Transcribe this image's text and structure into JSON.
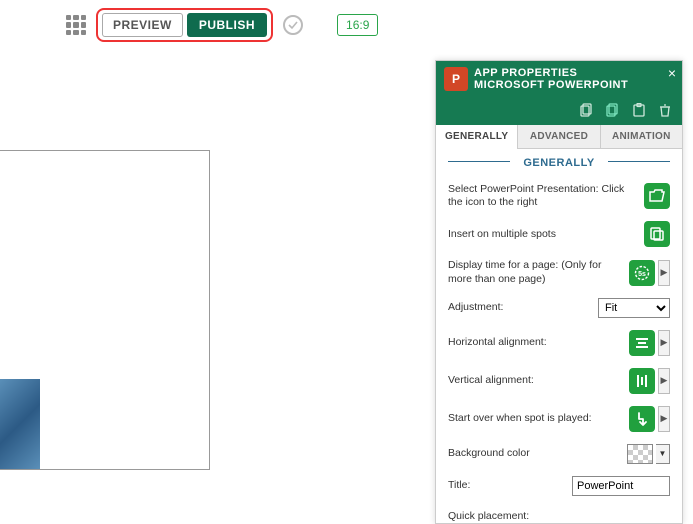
{
  "toolbar": {
    "preview_label": "PREVIEW",
    "publish_label": "PUBLISH",
    "aspect_label": "16:9"
  },
  "panel": {
    "title1": "APP PROPERTIES",
    "title2": "MICROSOFT POWERPOINT",
    "tabs": {
      "generally": "GENERALLY",
      "advanced": "ADVANCED",
      "animation": "ANIMATION"
    },
    "section_label": "GENERALLY",
    "rows": {
      "select_ppt": "Select PowerPoint Presentation: Click the icon to the right",
      "insert_multi": "Insert on multiple spots",
      "display_time": "Display time for a page: (Only for more than one page)",
      "adjustment_label": "Adjustment:",
      "adjustment_value": "Fit",
      "h_align": "Horizontal alignment:",
      "v_align": "Vertical alignment:",
      "start_over": "Start over when spot is played:",
      "bg_color": "Background color",
      "title_label": "Title:",
      "title_value": "PowerPoint",
      "quick_placement": "Quick placement:"
    }
  }
}
